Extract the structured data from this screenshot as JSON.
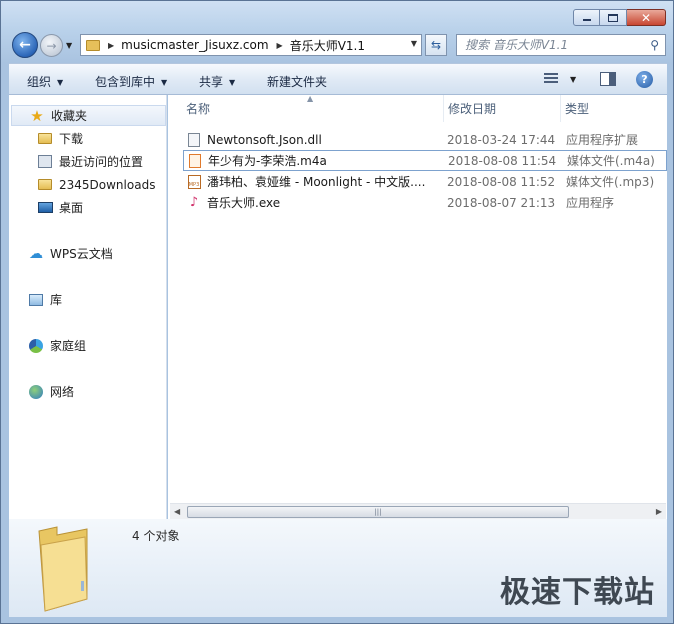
{
  "nav": {
    "back_label": "←",
    "forward_label": "→"
  },
  "address": {
    "crumbs": [
      "musicmaster_Jisuxz.com",
      "音乐大师V1.1"
    ]
  },
  "search": {
    "placeholder": "搜索 音乐大师V1.1"
  },
  "toolbar": {
    "organize": "组织",
    "include_in_library": "包含到库中",
    "share": "共享",
    "new_folder": "新建文件夹",
    "help": "?"
  },
  "sidebar": {
    "items": [
      {
        "label": "收藏夹",
        "icon": "star-icon"
      },
      {
        "label": "下载",
        "icon": "folder-icon"
      },
      {
        "label": "最近访问的位置",
        "icon": "recent-places-icon"
      },
      {
        "label": "2345Downloads",
        "icon": "folder-icon"
      },
      {
        "label": "桌面",
        "icon": "desktop-icon"
      },
      {
        "label": "WPS云文档",
        "icon": "cloud-icon"
      },
      {
        "label": "库",
        "icon": "library-icon"
      },
      {
        "label": "家庭组",
        "icon": "homegroup-icon"
      },
      {
        "label": "网络",
        "icon": "network-icon"
      }
    ]
  },
  "columns": {
    "name": "名称",
    "date": "修改日期",
    "type": "类型"
  },
  "files": [
    {
      "name": "Newtonsoft.Json.dll",
      "date": "2018-03-24 17:44",
      "type": "应用程序扩展",
      "icon": "dll-icon"
    },
    {
      "name": "年少有为-李荣浩.m4a",
      "date": "2018-08-08 11:54",
      "type": "媒体文件(.m4a)",
      "icon": "m4a-icon"
    },
    {
      "name": "潘玮柏、袁娅维 - Moonlight - 中文版....",
      "date": "2018-08-08 11:52",
      "type": "媒体文件(.mp3)",
      "icon": "mp3-icon"
    },
    {
      "name": "音乐大师.exe",
      "date": "2018-08-07 21:13",
      "type": "应用程序",
      "icon": "exe-icon"
    }
  ],
  "details": {
    "count": "4 个对象"
  },
  "watermark": "极速下载站",
  "scrollbar": {
    "grip": "|||"
  }
}
